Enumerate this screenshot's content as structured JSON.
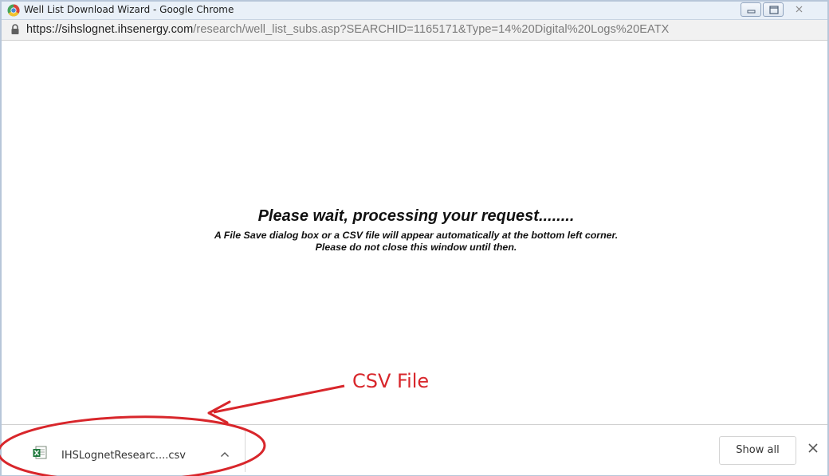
{
  "window": {
    "title": "Well List Download Wizard - Google Chrome",
    "app_icon": "chrome-icon"
  },
  "address_bar": {
    "url_host": "https://sihslognet.ihsenergy.com",
    "url_path": "/research/well_list_subs.asp?SEARCHID=1165171&Type=14%20Digital%20Logs%20EATX",
    "lock_icon": "lock-icon"
  },
  "content": {
    "heading": "Please wait, processing your request........",
    "line1": "A File Save dialog box or a CSV file will appear automatically at the bottom left corner.",
    "line2": "Please do not close this window until then."
  },
  "annotation": {
    "label": "CSV File",
    "color": "#d8262b"
  },
  "download_bar": {
    "file_name": "IHSLognetResearc....csv",
    "file_icon": "csv-file-icon",
    "show_all_label": "Show all",
    "close_icon": "close-icon",
    "chevron_icon": "chevron-up-icon"
  }
}
